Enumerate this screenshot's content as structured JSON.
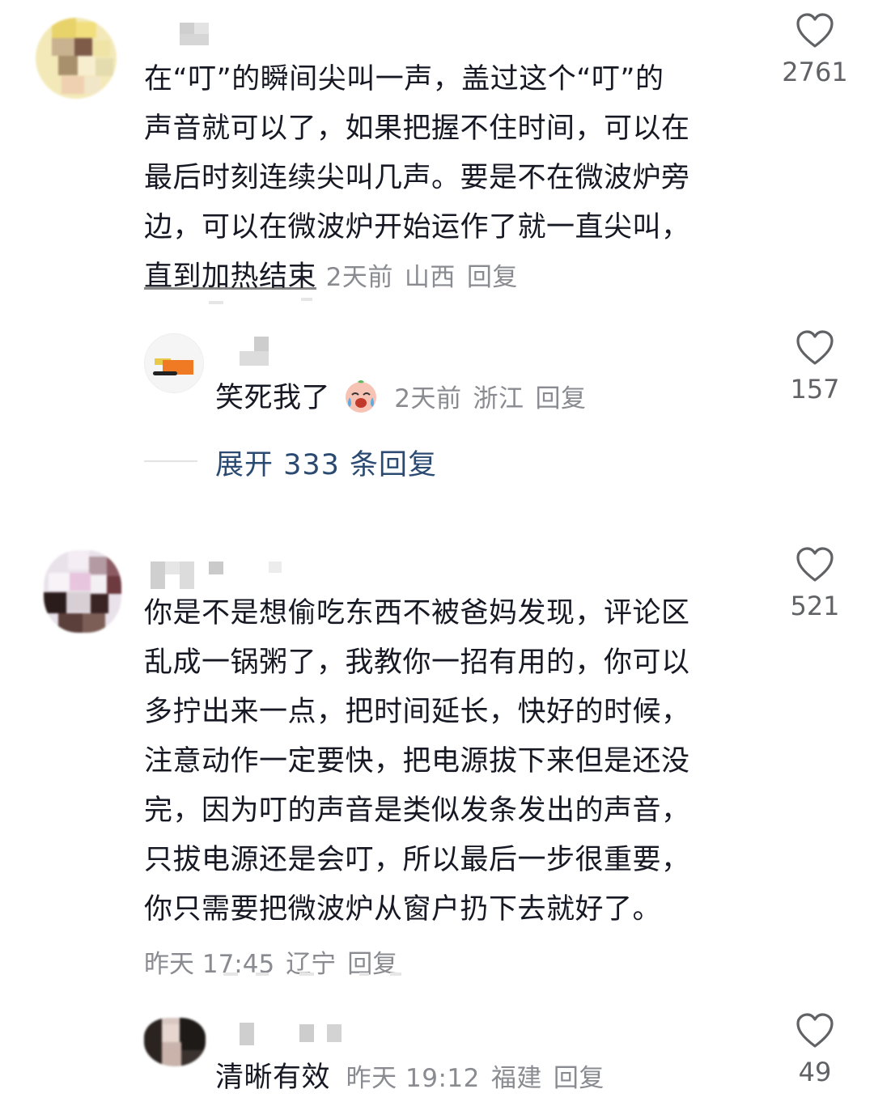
{
  "comments": [
    {
      "text_lines": [
        "在“叮”的瞬间尖叫一声，盖过这个“叮”的",
        "声音就可以了，如果把握不住时间，可以在",
        "最后时刻连续尖叫几声。要是不在微波炉旁",
        "边，可以在微波炉开始运作了就一直尖叫，",
        "直到加热结束"
      ],
      "time": "2天前",
      "location": "山西",
      "reply_label": "回复",
      "like_count": "2761"
    },
    {
      "text_lines": [
        "你是不是想偷吃东西不被爸妈发现，评论区",
        "乱成一锅粥了，我教你一招有用的，你可以",
        "多拧出来一点，把时间延长，快好的时候，",
        "注意动作一定要快，把电源拔下来但是还没",
        "完，因为叮的声音是类似发条发出的声音，",
        "只拔电源还是会叮，所以最后一步很重要，",
        "你只需要把微波炉从窗户扔下去就好了。"
      ],
      "time": "昨天 17:45",
      "location": "辽宁",
      "reply_label": "回复",
      "like_count": "521"
    }
  ],
  "replies": [
    {
      "text": "笑死我了",
      "emoji": "crying-laughing-face-emoji",
      "time": "2天前",
      "location": "浙江",
      "reply_label": "回复",
      "like_count": "157"
    },
    {
      "text": "清晰有效",
      "time": "昨天 19:12",
      "location": "福建",
      "reply_label": "回复",
      "like_count": "49"
    }
  ],
  "expand_replies": "展开 333 条回复",
  "colors": {
    "text": "#161823",
    "meta": "#8a8b91",
    "expand_link": "#2b4a72",
    "icon": "#606266"
  },
  "icons": {
    "like": "heart-outline-icon"
  }
}
